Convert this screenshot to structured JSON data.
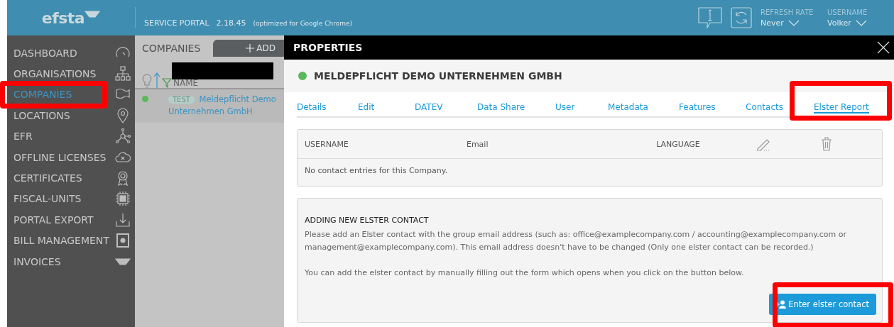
{
  "header": {
    "logo": "efsta",
    "portal": "SERVICE PORTAL",
    "version": "2.18.45",
    "note": "(optimized for Google Chrome)",
    "refresh": {
      "label": "REFRESH RATE",
      "value": "Never"
    },
    "user": {
      "label": "USERNAME",
      "value": "Volker"
    }
  },
  "sidebar": {
    "items": [
      {
        "label": "DASHBOARD",
        "selected": false,
        "highlighted": false
      },
      {
        "label": "ORGANISATIONS",
        "selected": false,
        "highlighted": false
      },
      {
        "label": "COMPANIES",
        "selected": true,
        "highlighted": true
      },
      {
        "label": "LOCATIONS",
        "selected": false,
        "highlighted": false
      },
      {
        "label": "EFR",
        "selected": false,
        "highlighted": false
      },
      {
        "label": "OFFLINE LICENSES",
        "selected": false,
        "highlighted": false
      },
      {
        "label": "CERTIFICATES",
        "selected": false,
        "highlighted": false
      },
      {
        "label": "FISCAL-UNITS",
        "selected": false,
        "highlighted": false
      },
      {
        "label": "PORTAL EXPORT",
        "selected": false,
        "highlighted": false
      },
      {
        "label": "BILL MANAGEMENT",
        "selected": false,
        "highlighted": false
      },
      {
        "label": "INVOICES",
        "selected": false,
        "highlighted": false
      }
    ]
  },
  "companies": {
    "title": "COMPANIES",
    "add": "ADD",
    "column": "NAME",
    "rows": [
      {
        "tag": "TEST",
        "name": "Meldepflicht Demo Unternehmen GmbH",
        "active": true
      }
    ]
  },
  "properties": {
    "title": "PROPERTIES",
    "company": "MELDEPFLICHT DEMO UNTERNEHMEN GMBH",
    "active": true,
    "tabs": [
      {
        "label": "Details",
        "selected": false,
        "highlighted": false
      },
      {
        "label": "Edit",
        "selected": false,
        "highlighted": false
      },
      {
        "label": "DATEV",
        "selected": false,
        "highlighted": false
      },
      {
        "label": "Data Share",
        "selected": false,
        "highlighted": false
      },
      {
        "label": "User",
        "selected": false,
        "highlighted": false
      },
      {
        "label": "Metadata",
        "selected": false,
        "highlighted": false
      },
      {
        "label": "Features",
        "selected": false,
        "highlighted": false
      },
      {
        "label": "Contacts",
        "selected": false,
        "highlighted": false
      },
      {
        "label": "Elster Report",
        "selected": true,
        "highlighted": true
      }
    ],
    "table": {
      "columns": [
        "USERNAME",
        "Email",
        "LANGUAGE"
      ],
      "empty": "No contact entries for this Company."
    },
    "add_section": {
      "title": "ADDING NEW ELSTER CONTACT",
      "text": "Please add an Elster contact with the group email address (such as: office@examplecompany.com / accounting@examplecompany.com or management@examplecompany.com). This email address doesn't have to be changed (Only one elster contact can be recorded.)",
      "hint": "You can add the elster contact by manually filling out the form which opens when you click on the button below.",
      "button": {
        "label": "Enter elster contact",
        "highlighted": true
      }
    }
  }
}
